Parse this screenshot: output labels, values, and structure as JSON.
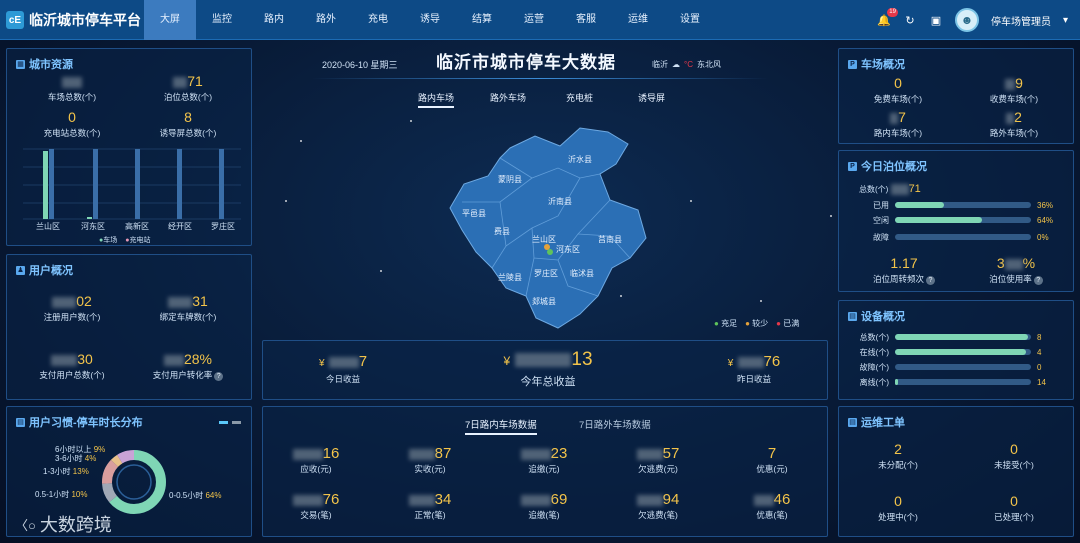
{
  "app": {
    "title": "临沂城市停车平台",
    "logo_text": "cE"
  },
  "nav": [
    "大屏",
    "监控",
    "路内",
    "路外",
    "充电",
    "诱导",
    "结算",
    "运营",
    "客服",
    "运维",
    "设置"
  ],
  "header_right": {
    "notification_count": "19",
    "user_name": "停车场管理员"
  },
  "center_header": {
    "date": "2020-06-10 星期三",
    "title": "临沂市城市停车大数据",
    "weather_city": "临沂",
    "weather_temp": "°C",
    "wind": "东北风"
  },
  "center_tabs": [
    "路内车场",
    "路外车场",
    "充电桩",
    "诱导屏"
  ],
  "city_resources": {
    "title": "城市资源",
    "stats": [
      {
        "value": "71",
        "label": "泊位总数(个)"
      },
      {
        "value": "",
        "label": "车场总数(个)"
      },
      {
        "value": "0",
        "label": "充电站总数(个)"
      },
      {
        "value": "8",
        "label": "诱导屏总数(个)"
      }
    ],
    "chart_districts": [
      "兰山区",
      "河东区",
      "高新区",
      "经开区",
      "罗庄区"
    ],
    "legend": [
      "车场",
      "充电站"
    ]
  },
  "user_overview": {
    "title": "用户概况",
    "stats": [
      {
        "value": "02",
        "label": "注册用户数(个)"
      },
      {
        "value": "31",
        "label": "绑定车牌数(个)"
      },
      {
        "value": "30",
        "label": "支付用户总数(个)"
      },
      {
        "value": "28%",
        "label": "支付用户转化率"
      }
    ]
  },
  "parking_duration": {
    "title": "用户习惯-停车时长分布",
    "items": [
      {
        "label": "6小时以上",
        "pct": "9%",
        "color": "#c9a3d6"
      },
      {
        "label": "3-6小时",
        "pct": "4%",
        "color": "#e8c089"
      },
      {
        "label": "1-3小时",
        "pct": "13%",
        "color": "#d99e9e"
      },
      {
        "label": "0.5-1小时",
        "pct": "10%",
        "color": "#a0a8b6"
      },
      {
        "label": "0-0.5小时",
        "pct": "64%",
        "color": "#7fd6b5"
      }
    ]
  },
  "map_labels": [
    "沂水县",
    "蒙阴县",
    "沂南县",
    "平邑县",
    "费县",
    "兰山区",
    "河东区",
    "莒南县",
    "罗庄区",
    "兰陵县",
    "临沭县",
    "郯城县"
  ],
  "map_legend": [
    "充足",
    "较少",
    "已满"
  ],
  "revenue": {
    "today": {
      "value": "7",
      "label": "今日收益"
    },
    "year": {
      "value": "13",
      "label": "今年总收益"
    },
    "yesterday": {
      "value": "76",
      "label": "昨日收益"
    },
    "currency": "¥"
  },
  "weekly": {
    "tabs": [
      "7日路内车场数据",
      "7日路外车场数据"
    ],
    "row1": [
      {
        "value": "16",
        "label": "应收(元)"
      },
      {
        "value": "87",
        "label": "实收(元)"
      },
      {
        "value": "23",
        "label": "追缴(元)"
      },
      {
        "value": "57",
        "label": "欠逃费(元)"
      },
      {
        "value": "7",
        "label": "优惠(元)"
      }
    ],
    "row2": [
      {
        "value": "76",
        "label": "交易(笔)"
      },
      {
        "value": "34",
        "label": "正常(笔)"
      },
      {
        "value": "69",
        "label": "追缴(笔)"
      },
      {
        "value": "94",
        "label": "欠逃费(笔)"
      },
      {
        "value": "46",
        "label": "优惠(笔)"
      }
    ]
  },
  "lot_overview": {
    "title": "车场概况",
    "stats": [
      {
        "value": "0",
        "label": "免费车场(个)"
      },
      {
        "value": "9",
        "label": "收费车场(个)"
      },
      {
        "value": "7",
        "label": "路内车场(个)"
      },
      {
        "value": "2",
        "label": "路外车场(个)"
      }
    ]
  },
  "berth_today": {
    "title": "今日泊位概况",
    "total_label": "总数(个)",
    "total_value": "71",
    "rows": [
      {
        "label": "已用",
        "pct": "36%",
        "fraction": 0.36
      },
      {
        "label": "空闲",
        "pct": "64%",
        "fraction": 0.64
      },
      {
        "label": "故障",
        "pct": "0%",
        "fraction": 0
      }
    ],
    "turnover": {
      "value": "1.17",
      "label": "泊位周转频次"
    },
    "usage": {
      "value": "%",
      "label": "泊位使用率"
    }
  },
  "device_overview": {
    "title": "设备概况",
    "rows": [
      {
        "label": "总数(个)",
        "value": "8",
        "fraction": 0.98
      },
      {
        "label": "在线(个)",
        "value": "4",
        "fraction": 0.96
      },
      {
        "label": "故障(个)",
        "value": "0",
        "fraction": 0
      },
      {
        "label": "离线(个)",
        "value": "14",
        "fraction": 0.02
      }
    ]
  },
  "work_orders": {
    "title": "运维工单",
    "stats": [
      {
        "value": "2",
        "label": "未分配(个)"
      },
      {
        "value": "0",
        "label": "未接受(个)"
      },
      {
        "value": "0",
        "label": "处理中(个)"
      },
      {
        "value": "0",
        "label": "已处理(个)"
      }
    ]
  },
  "watermark": "大数跨境"
}
